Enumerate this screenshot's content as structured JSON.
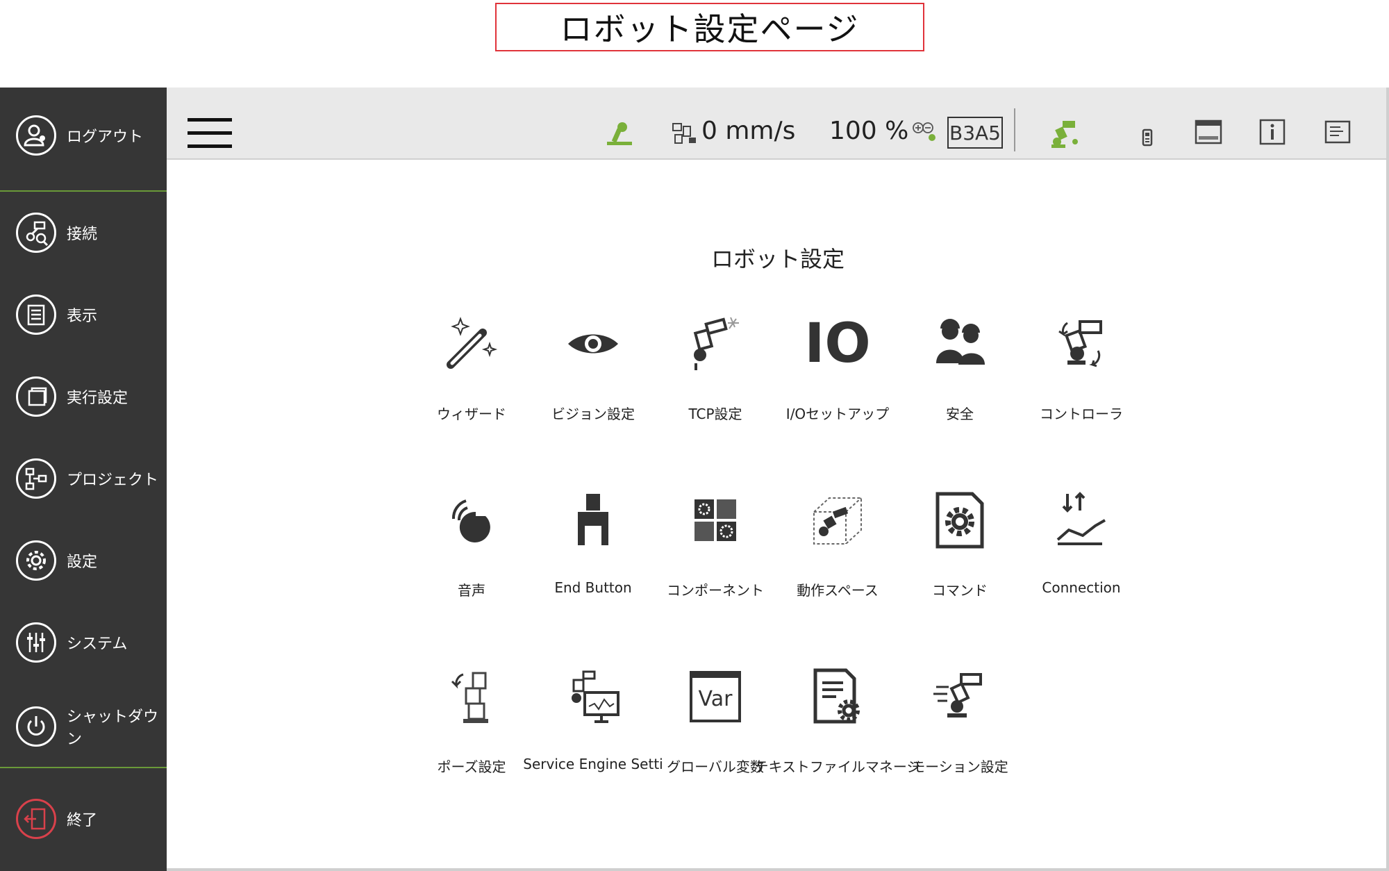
{
  "page_title": "ロボット設定ページ",
  "sidebar": {
    "items": [
      {
        "label": "ログアウト",
        "icon": "logout-user-icon"
      },
      {
        "label": "接続",
        "icon": "connection-icon"
      },
      {
        "label": "表示",
        "icon": "display-list-icon"
      },
      {
        "label": "実行設定",
        "icon": "run-settings-icon"
      },
      {
        "label": "プロジェクト",
        "icon": "project-flow-icon"
      },
      {
        "label": "設定",
        "icon": "gear-icon"
      },
      {
        "label": "システム",
        "icon": "sliders-icon"
      },
      {
        "label": "シャットダウン",
        "icon": "power-icon"
      },
      {
        "label": "終了",
        "icon": "exit-icon"
      }
    ]
  },
  "topbar": {
    "speed": "0 mm/s",
    "percent": "100 %",
    "tag": "B3A5",
    "accent": "#7ab03a"
  },
  "main": {
    "section_title": "ロボット設定",
    "tiles": [
      {
        "label": "ウィザード",
        "icon": "wizard-wand-icon"
      },
      {
        "label": "ビジョン設定",
        "icon": "vision-eye-icon"
      },
      {
        "label": "TCP設定",
        "icon": "tcp-tool-icon"
      },
      {
        "label": "I/Oセットアップ",
        "icon": "io-icon",
        "icon_text": "IO"
      },
      {
        "label": "安全",
        "icon": "safety-workers-icon"
      },
      {
        "label": "コントローラ",
        "icon": "controller-robot-icon"
      },
      {
        "label": "音声",
        "icon": "voice-icon"
      },
      {
        "label": "End Button",
        "icon": "end-button-gripper-icon"
      },
      {
        "label": "コンポーネント",
        "icon": "component-icon"
      },
      {
        "label": "動作スペース",
        "icon": "workspace-cube-icon"
      },
      {
        "label": "コマンド",
        "icon": "command-file-gear-icon"
      },
      {
        "label": "Connection",
        "icon": "connection-chart-icon"
      },
      {
        "label": "ポーズ設定",
        "icon": "pose-robot-icon"
      },
      {
        "label": "Service Engine Setti",
        "icon": "service-engine-icon"
      },
      {
        "label": "グローバル変数",
        "icon": "global-variable-icon",
        "icon_text": "Var"
      },
      {
        "label": "テキストファイルマネージ",
        "icon": "text-file-manager-icon"
      },
      {
        "label": "モーション設定",
        "icon": "motion-settings-icon"
      }
    ]
  }
}
